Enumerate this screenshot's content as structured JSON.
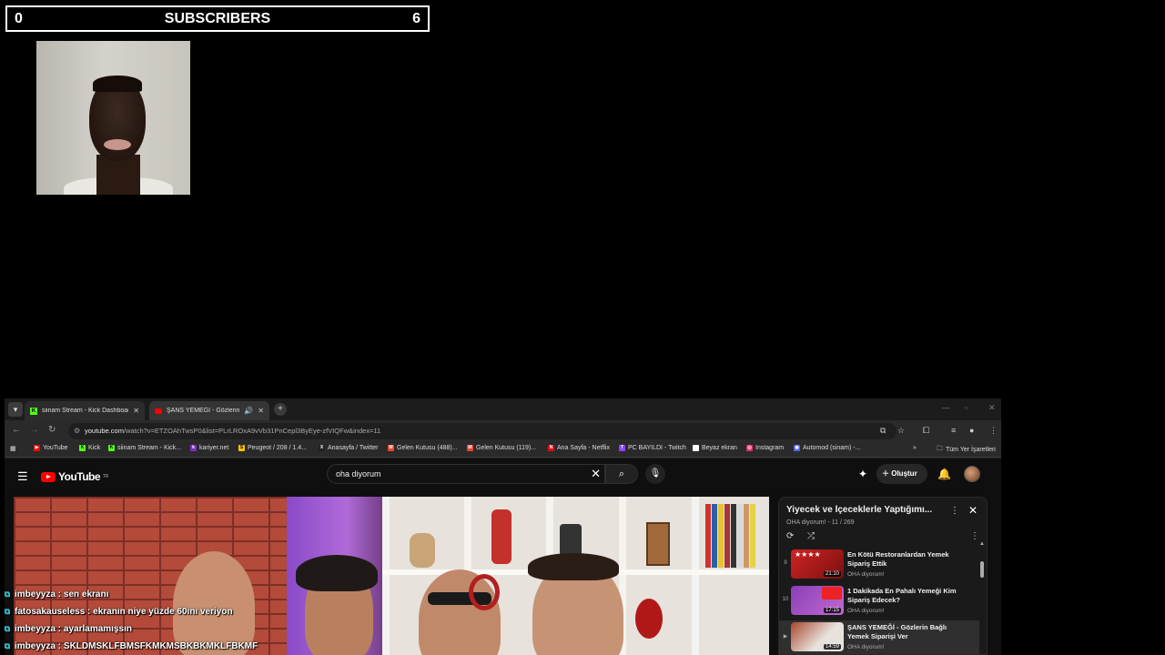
{
  "overlay": {
    "subscribers": {
      "left": "0",
      "title": "SUBSCRIBERS",
      "right": "6"
    }
  },
  "browser": {
    "tabs": [
      {
        "title": "siinam Stream - Kick Dashboard",
        "favicon": "kick-icon"
      },
      {
        "title": "ŞANS YEMEĞİ - Gözlerin Bağlı",
        "favicon": "youtube-icon"
      }
    ],
    "url_host": "youtube.com",
    "url_path": "/watch?v=ETZOAhTwsP0&list=PLrLROxA9vVb31PnCepl3ByEye-zfVIQFw&index=11",
    "bookmarks": [
      {
        "label": "YouTube",
        "color": "#ff0000",
        "glyph": "▶"
      },
      {
        "label": "Kick",
        "color": "#53fc18",
        "glyph": "K"
      },
      {
        "label": "siinam Stream - Kick...",
        "color": "#53fc18",
        "glyph": "K"
      },
      {
        "label": "kariyer.net",
        "color": "#7b2fbe",
        "glyph": "k"
      },
      {
        "label": "Peugeot / 208 / 1.4...",
        "color": "#f5c400",
        "glyph": "S"
      },
      {
        "label": "Anasayfa / Twitter",
        "color": "#222222",
        "glyph": "X"
      },
      {
        "label": "Gelen Kutusu (488)...",
        "color": "#ea4335",
        "glyph": "M"
      },
      {
        "label": "Gelen Kutusu (119)...",
        "color": "#ea4335",
        "glyph": "M"
      },
      {
        "label": "Ana Sayfa - Netflix",
        "color": "#e50914",
        "glyph": "N"
      },
      {
        "label": "PC BAYILDI - Twitch",
        "color": "#9146ff",
        "glyph": "T"
      },
      {
        "label": "Beyaz ekran",
        "color": "#ffffff",
        "glyph": ""
      },
      {
        "label": "Instagram",
        "color": "#e1306c",
        "glyph": "◎"
      },
      {
        "label": "Automod (sinam) -...",
        "color": "#5865f2",
        "glyph": "◉"
      }
    ],
    "all_bookmarks": "Tüm Yer İşaretleri"
  },
  "youtube": {
    "logo": "YouTube",
    "logo_sup": "TR",
    "search_value": "oha diyorum",
    "create_label": "Oluştur",
    "playlist": {
      "title": "Yiyecek ve İçeceklerle Yaptığımı...",
      "subtitle": "OHA diyorum! - 11 / 269",
      "items": [
        {
          "index": "9",
          "title": "En Kötü Restoranlardan Yemek Sipariş Ettik",
          "channel": "OHA diyorum!",
          "duration": "21:10"
        },
        {
          "index": "10",
          "title": "1 Dakikada En Pahalı Yemeği Kim Sipariş Edecek?",
          "channel": "OHA diyorum!",
          "duration": "17:15"
        },
        {
          "index": "▶",
          "title": "ŞANS YEMEĞİ - Gözlerin Bağlı Yemek Siparişi Ver",
          "channel": "OHA diyorum!",
          "duration": "14:59"
        }
      ]
    }
  },
  "chat": [
    {
      "text": "imbeyyza : sen ekranı"
    },
    {
      "text": "fatosakauseless : ekranın niye yüzde 60ını veriyon"
    },
    {
      "text": "imbeyyza : ayarlamamışsın"
    },
    {
      "text": "imbeyyza : SKLDMSKLFBMSFKMKMSBKBKMKLFBKMF"
    }
  ]
}
